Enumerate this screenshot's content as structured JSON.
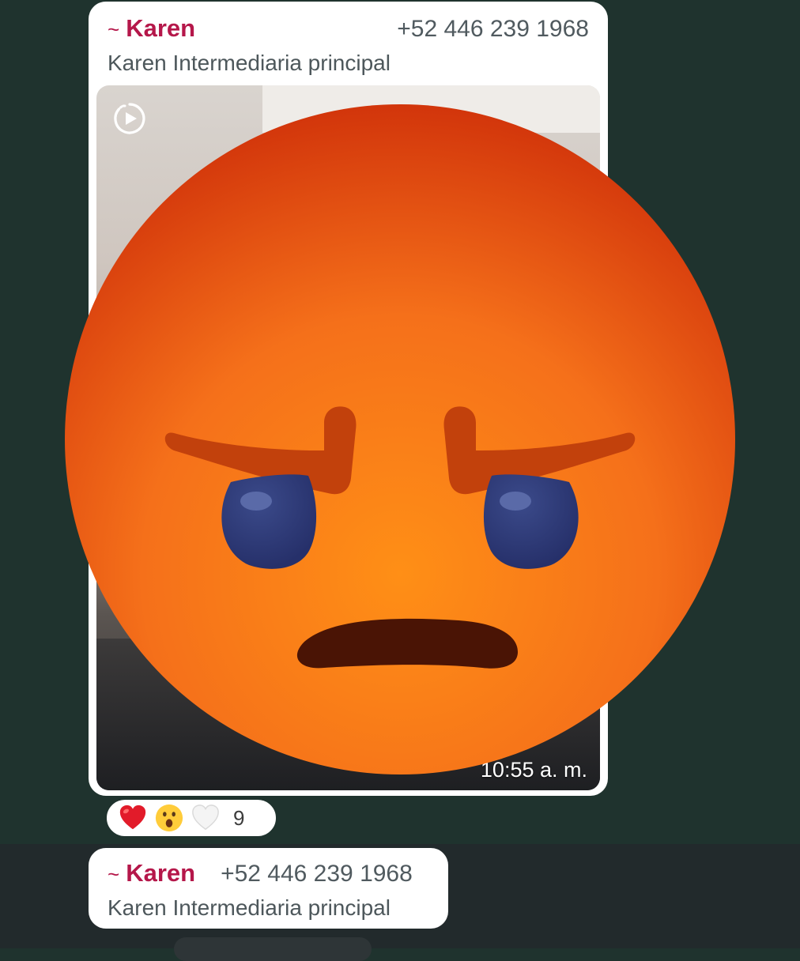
{
  "messages": [
    {
      "sender_prefix": "~",
      "sender_name": "Karen",
      "phone": "+52 446 239 1968",
      "description": "Karen Intermediaria principal",
      "media_icon": "view-once-icon",
      "timestamp": "10:55 a. m."
    },
    {
      "sender_prefix": "~",
      "sender_name": "Karen",
      "phone": "+52 446 239 1968",
      "description": "Karen Intermediaria principal"
    }
  ],
  "reactions": {
    "emojis": [
      "red-heart",
      "astonished-face",
      "white-heart"
    ],
    "count": "9"
  },
  "overlay": {
    "icon": "angry-face-emoji"
  },
  "colors": {
    "chat_background": "#1f332e",
    "bubble": "#ffffff",
    "sender_name": "#b5174a",
    "emoji_top": "#d2350b",
    "emoji_bottom": "#ff8a14"
  }
}
